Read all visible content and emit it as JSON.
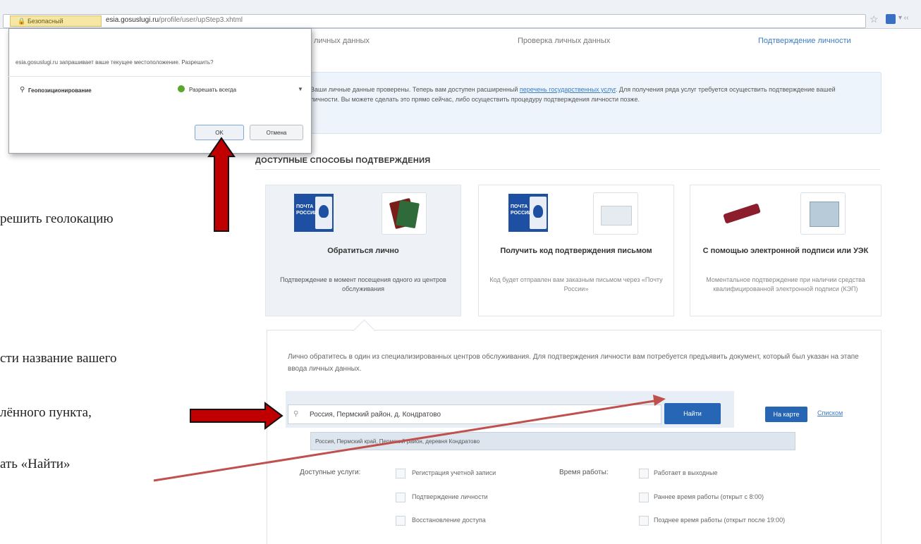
{
  "browser": {
    "security_label": "Безопасный",
    "url_domain": "esia.gosuslugi.ru",
    "url_path": "/profile/user/upStep3.xhtml",
    "star_icon": "star-icon",
    "extension_more": "▾ ‹‹"
  },
  "steps": {
    "step_1": "личных данных",
    "step_2": "Проверка личных данных",
    "step_3": "Подтверждение личности"
  },
  "info": {
    "text_before": "Ваши личные данные проверены. Теперь вам доступен расширенный ",
    "link": "перечень государственных услуг",
    "text_after": ". Для получения ряда услуг требуется осуществить подтверждение вашей личности. Вы можете сделать это прямо сейчас, либо осуществить процедуру подтверждения личности позже."
  },
  "methods": {
    "title": "ДОСТУПНЫЕ СПОСОБЫ ПОДТВЕРЖДЕНИЯ",
    "pochta_label": "ПОЧТА РОССИИ",
    "cards": [
      {
        "title": "Обратиться лично",
        "description": "Подтверждение в момент посещения одного из центров обслуживания"
      },
      {
        "title": "Получить код подтверждения письмом",
        "description": "Код будет отправлен вам заказным письмом через «Почту России»"
      },
      {
        "title": "С помощью электронной подписи или УЭК",
        "description": "Моментальное подтверждение при наличии средства квалифицированной электронной подписи (КЭП)"
      }
    ]
  },
  "lower": {
    "text": "Лично обратитесь в один из специализированных центров обслуживания. Для подтверждения личности вам потребуется предъявить документ, который был указан на этапе ввода личных данных.",
    "search_value": "Россия, Пермский район, д. Кондратово",
    "find_label": "Найти",
    "map_label": "На карте",
    "list_label": "Списком",
    "suggestion": "Россия, Пермский край, Пермский район, деревня Кондратово",
    "services_label": "Доступные услуги:",
    "services": [
      "Регистрация учетной записи",
      "Подтверждение личности",
      "Восстановление доступа"
    ],
    "hours_label": "Время работы:",
    "hours": [
      "Работает в выходные",
      "Раннее время работы (открыт с 8:00)",
      "Позднее время работы (открыт после 19:00)"
    ]
  },
  "dialog": {
    "message": "esia.gosuslugi.ru запрашивает ваше текущее местоположение. Разрешить?",
    "geo_label": "Геопозиционирование",
    "allow_option": "Разрешать всегда",
    "ok_label": "OK",
    "cancel_label": "Отмена"
  },
  "annotations": {
    "line_1": "решить геолокацию",
    "line_2": "сти название вашего",
    "line_3": "лённого пункта,",
    "line_4": "ать  «Найти»",
    "arrow_color": "#c00000",
    "pointer_color": "#c0504d"
  }
}
